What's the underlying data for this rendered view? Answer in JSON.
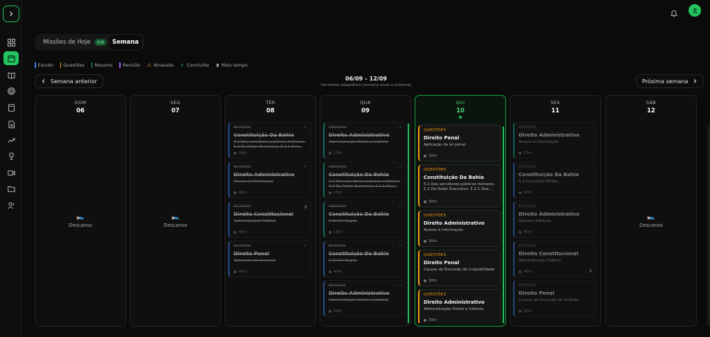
{
  "colors": {
    "estudo": "#3b82f6",
    "questoes": "#f59e0b",
    "resumo": "#14b8a6",
    "revisao": "#a855f7",
    "accent": "#22c55e"
  },
  "sidebar": {
    "icons": [
      "chevron-right-icon",
      "dashboard-icon",
      "calendar-icon",
      "book-icon",
      "target-icon",
      "notebook-icon",
      "file-icon",
      "trending-icon",
      "trophy-icon",
      "video-icon",
      "folder-icon",
      "users-icon"
    ]
  },
  "header": {
    "bell_icon": "bell-icon",
    "avatar_icon": "user-icon"
  },
  "tabs": {
    "today": "Missões de Hoje",
    "today_badge": "0/6",
    "week": "Semana"
  },
  "legend": {
    "estudo": "Estudo",
    "questoes": "Questões",
    "resumo": "Resumo",
    "revisao": "Revisão",
    "atrasada": "Atrasada",
    "concluida": "Concluída",
    "mais_tempo": "Mais tempo"
  },
  "nav": {
    "prev": "Semana anterior",
    "next": "Próxima semana",
    "range": "06/09 – 12/09",
    "range_sub": "Horizonte adaptativo (semana atual e próxima)"
  },
  "rest_label": "Descanso",
  "days": [
    {
      "dn": "DOM",
      "dd": "06"
    },
    {
      "dn": "SEG",
      "dd": "07"
    },
    {
      "dn": "TER",
      "dd": "08"
    },
    {
      "dn": "QUA",
      "dd": "09"
    },
    {
      "dn": "QUI",
      "dd": "10"
    },
    {
      "dn": "SEX",
      "dd": "11"
    },
    {
      "dn": "SÁB",
      "dd": "12"
    }
  ],
  "ter": [
    {
      "type": "ESTUDO",
      "title": "Constituição Da Bahia",
      "desc": "5.1 Dos servidores públicos militares. 5.2 Do Poder Executivo. 5.2.1 Dos...",
      "dur": "40m"
    },
    {
      "type": "ESTUDO",
      "title": "Direito Administrativo",
      "desc": "Acesso à Informação",
      "dur": "40m"
    },
    {
      "type": "ESTUDO",
      "title": "Direito Constitucional",
      "desc": "Administração Pública",
      "dur": "40m"
    },
    {
      "type": "ESTUDO",
      "title": "Direito Penal",
      "desc": "Aplicação da lei penal",
      "dur": "40m"
    }
  ],
  "qua": [
    {
      "type": "RESUMO",
      "title": "Direito Administrativo",
      "desc": "Administração Direta e Indireta",
      "dur": "15m"
    },
    {
      "type": "RESUMO",
      "title": "Constituição Da Bahia",
      "desc": "5.1 Dos servidores públicos militares. 5.2 Do Poder Executivo. 5.2.1 Dos...",
      "dur": "15m"
    },
    {
      "type": "RESUMO",
      "title": "Constituição Da Bahia",
      "desc": "5.10 Do Negro.",
      "dur": "15m"
    },
    {
      "type": "ESTUDO",
      "title": "Constituição Da Bahia",
      "desc": "5.10 Do Negro.",
      "dur": "40m"
    },
    {
      "type": "ESTUDO",
      "title": "Direito Administrativo",
      "desc": "Administração Direta e Indireta",
      "dur": "40m"
    }
  ],
  "qui": [
    {
      "type": "QUESTÕES",
      "title": "Direito Penal",
      "desc": "Aplicação da lei penal",
      "dur": "30m"
    },
    {
      "type": "QUESTÕES",
      "title": "Constituição Da Bahia",
      "desc": "5.1 Dos servidores públicos militares. 5.2 Do Poder Executivo. 5.2.1 Dos...",
      "dur": "30m"
    },
    {
      "type": "QUESTÕES",
      "title": "Direito Administrativo",
      "desc": "Acesso à informação",
      "dur": "30m"
    },
    {
      "type": "QUESTÕES",
      "title": "Direito Penal",
      "desc": "Causas de Exclusão de Culpabilidade",
      "dur": "30m"
    },
    {
      "type": "QUESTÕES",
      "title": "Direito Administrativo",
      "desc": "Administração Direta e Indireta",
      "dur": "30m"
    }
  ],
  "sex": [
    {
      "type": "RESUMO",
      "title": "Direito Administrativo",
      "desc": "Acesso à Informação",
      "dur": "15m"
    },
    {
      "type": "ESTUDO",
      "title": "Constituição Da Bahia",
      "desc": "5.3 Da Justiça Militar.",
      "dur": "40m"
    },
    {
      "type": "ESTUDO",
      "title": "Direito Administrativo",
      "desc": "Agentes Públicos",
      "dur": "40m"
    },
    {
      "type": "ESTUDO",
      "title": "Direito Constitucional",
      "desc": "Administração Pública",
      "dur": "40m"
    },
    {
      "type": "ESTUDO",
      "title": "Direito Penal",
      "desc": "Causas de Exclusão de Ilicitude",
      "dur": "40m"
    }
  ]
}
